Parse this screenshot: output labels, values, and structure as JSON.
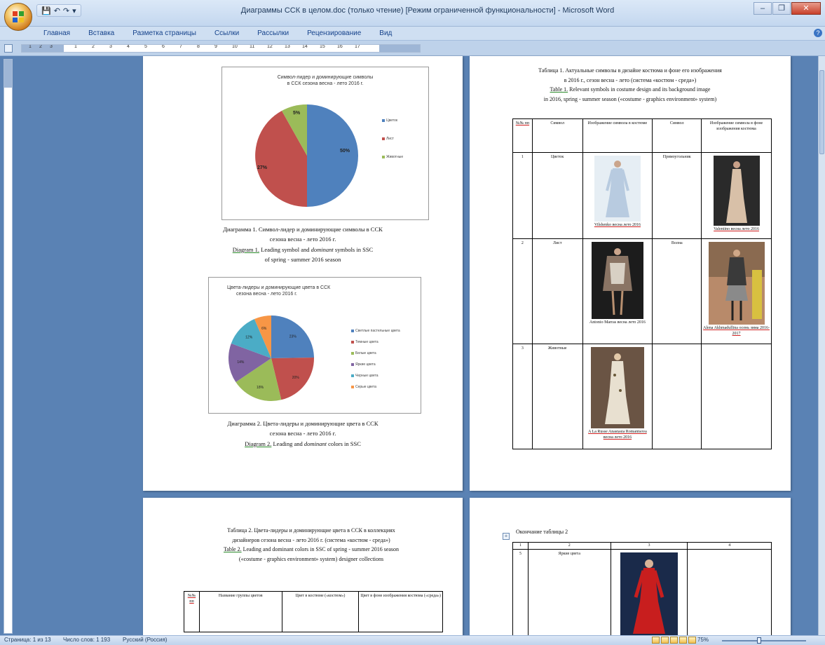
{
  "window": {
    "title": "Диаграммы ССК в целом.doc (только чтение) [Режим ограниченной функциональности] - Microsoft Word",
    "minimize": "–",
    "restore": "❐",
    "close": "✕"
  },
  "qat": {
    "save": "💾",
    "undo": "↶",
    "redo": "↷",
    "more": "▾"
  },
  "ribbon_tabs": [
    "Главная",
    "Вставка",
    "Разметка страницы",
    "Ссылки",
    "Рассылки",
    "Рецензирование",
    "Вид"
  ],
  "ruler_numbers": [
    "1",
    "2",
    "3",
    "1",
    "2",
    "3",
    "4",
    "5",
    "6",
    "7",
    "8",
    "9",
    "10",
    "11",
    "12",
    "13",
    "14",
    "15",
    "16",
    "17"
  ],
  "page1": {
    "chart1": {
      "title_lines": [
        "Символ-лидер и доминирующие символы",
        "в ССК  сезона весна - лето 2016 г."
      ],
      "labels": [
        "50%",
        "27%",
        "5%"
      ],
      "legend": [
        "Цветок",
        "Лист",
        "Животные"
      ]
    },
    "caption1_lines": [
      "Диаграмма  1.  Символ-лидер и доминирующие символы в ССК",
      "сезона весна - лето 2016 г."
    ],
    "caption1_en": {
      "prefix": "Diagram 1.",
      "text": " Leading symbol and ",
      "em": "dominant",
      "rest": " symbols in SSC",
      "line2": "of spring - summer 2016 season"
    },
    "chart2": {
      "title_lines": [
        "Цвета-лидеры и доминирующие цвета в ССК",
        "сезона весна - лето 2016 г."
      ],
      "labels": [
        "23%",
        "20%",
        "18%",
        "14%",
        "12%",
        "6%"
      ],
      "legend": [
        "Светлые пастельные цвета",
        "Темные цвета",
        "Белые цвета",
        "Яркие цвета",
        "Черные цвета",
        "Серые цвета"
      ]
    },
    "caption2_lines": [
      "Диаграмма 2. Цвета-лидеры и доминирующие цвета в ССК",
      "сезона весна - лето 2016 г."
    ],
    "caption2_en": {
      "prefix": "Diagram 2.",
      "text": " Leading and ",
      "em": "dominant",
      "rest": " colors in SSC"
    }
  },
  "page2": {
    "title_lines": [
      "Таблица 1. Актуальные символы в дизайне костюма и фоне его изображения",
      "в 2016 г., сезон весна - лето (система «костюм - среда»)"
    ],
    "title_en_prefix": "Table 1.",
    "title_en_1": " Relevant symbols in costume design and its background image",
    "title_en_2": "in 2016, spring - summer season («costume - graphics environment» system)",
    "headers": [
      "№№ пп",
      "Символ",
      "Изображение символа в костюме",
      "Символ",
      "Изображение символа в фоне изображения костюма"
    ],
    "rows": [
      {
        "n": "1",
        "s1": "Цветок",
        "cap1": "Vilshenko весна лето 2016",
        "s2": "Прямоугольник",
        "cap2": "Valentino весна лето 2016"
      },
      {
        "n": "2",
        "s1": "Лист",
        "cap1": "Antonio Marras весна лето 2016",
        "s2": "Волна",
        "cap2": "Alena Akhmadullina осень зима 2016-2017"
      },
      {
        "n": "3",
        "s1": "Животные",
        "cap1": "A La Russe Anastasia Romantsova весна лето 2016",
        "s2": "",
        "cap2": ""
      }
    ]
  },
  "page3": {
    "title_lines": [
      "Таблица 2. Цвета-лидеры и доминирующие цвета в ССК в коллекциях",
      "дизайнеров сезона весна - лето 2016 г. (система «костюм - среда»)"
    ],
    "title_en_prefix": "Table 2.",
    "title_en_1": " Leading and dominant colors in SSC of spring - summer 2016 season",
    "title_en_2": "(«costume - graphics environment» system) designer collections",
    "headers": [
      "№№ пп",
      "Название группы цветов",
      "Цвет в костюме («костюм»)",
      "Цвет в фоне изображения костюма («среда»)"
    ]
  },
  "page4": {
    "title": "Окончание таблицы 2",
    "headers": [
      "1",
      "2",
      "3",
      "4"
    ],
    "row": {
      "n": "5",
      "name": "Яркие цвета"
    },
    "move_handle": "+"
  },
  "status": {
    "page": "Страница: 1 из 13",
    "words": "Число слов: 1 193",
    "lang": "Русский (Россия)",
    "zoom": "75%"
  },
  "colors": {
    "pie_blue": "#4f81bd",
    "pie_red": "#c0504d",
    "pie_green": "#9bbb59",
    "pie_purple": "#8064a2",
    "pie_teal": "#4bacc6",
    "pie_orange": "#f79646"
  }
}
